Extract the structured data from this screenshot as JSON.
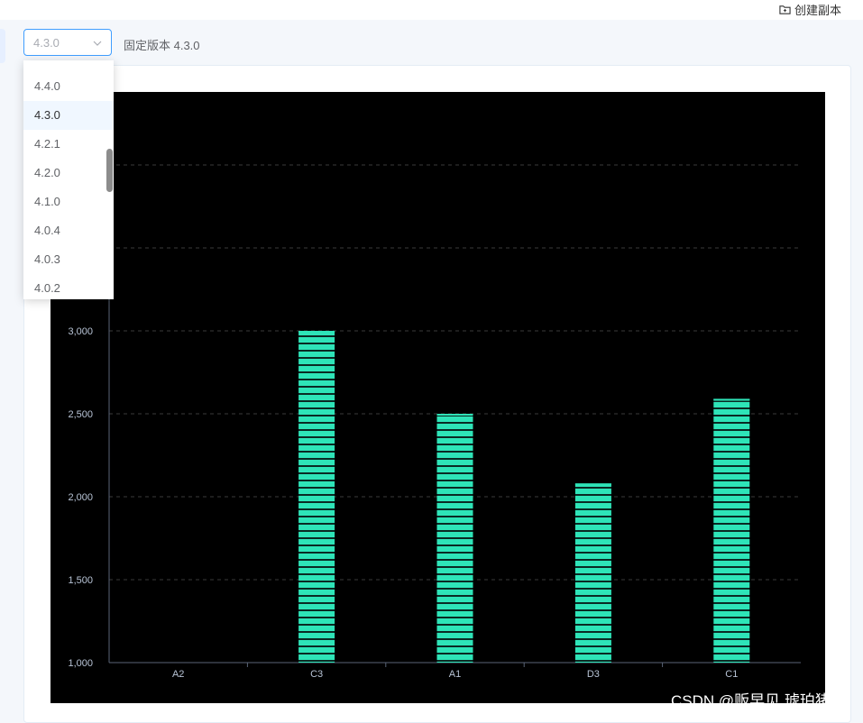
{
  "toolbar": {
    "copy_label": "创建副本",
    "copy_icon": "folder-icon"
  },
  "version_select": {
    "value": "4.3.0",
    "fixed_label": "固定版本 4.3.0",
    "options": [
      "4.4.0",
      "4.3.0",
      "4.2.1",
      "4.2.0",
      "4.1.0",
      "4.0.4",
      "4.0.3",
      "4.0.2"
    ],
    "selected_index": 1
  },
  "chart_data": {
    "type": "bar",
    "categories": [
      "A2",
      "C3",
      "A1",
      "D3",
      "C1"
    ],
    "values": [
      1000,
      3000,
      2500,
      2080,
      2590
    ],
    "ylim": [
      1000,
      4000
    ],
    "yticks_visible": [
      "1,000",
      "1,500",
      "2,000",
      "2,500",
      "3,000"
    ],
    "grid": true,
    "background": "#000000",
    "bar_color": "#2ee4b8",
    "bar_pattern": "horizontal-stripes"
  },
  "watermark": "CSDN @贩早见.琥珀猪"
}
